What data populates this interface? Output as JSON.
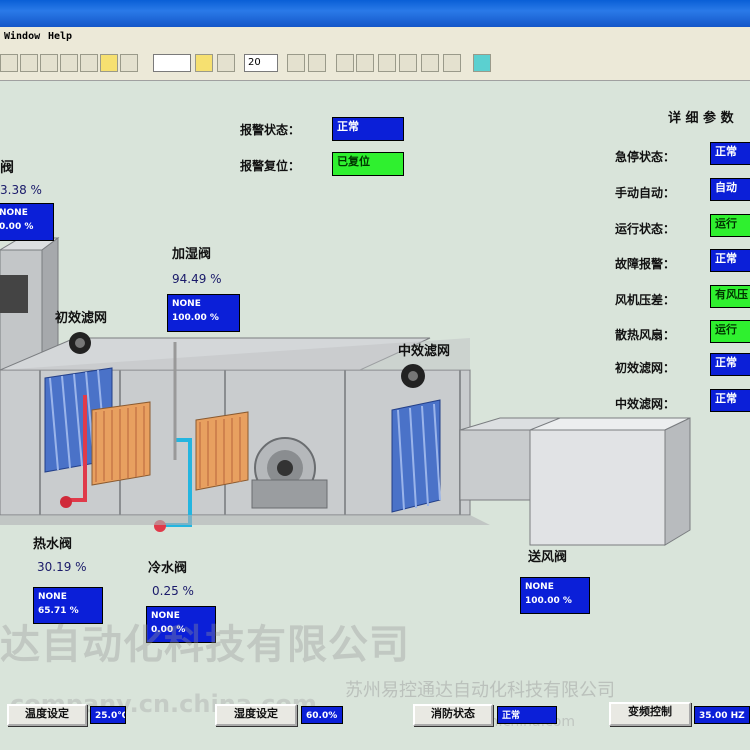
{
  "menu": {
    "window": "Window",
    "help": "Help"
  },
  "toolbar": {
    "zoom": "20"
  },
  "alarm": {
    "status_label": "报警状态：",
    "status_value": "正常",
    "reset_label": "报警复位：",
    "reset_value": "已复位"
  },
  "details": {
    "title": "详 细 参 数",
    "rows": [
      {
        "label": "急停状态：",
        "value": "正常",
        "color": "#0b1fd8"
      },
      {
        "label": "手动自动：",
        "value": "自动",
        "color": "#0b1fd8"
      },
      {
        "label": "运行状态：",
        "value": "运行",
        "color": "#2ff02f"
      },
      {
        "label": "故障报警：",
        "value": "正常",
        "color": "#0b1fd8"
      },
      {
        "label": "风机压差：",
        "value": "有风压",
        "color": "#2ff02f"
      },
      {
        "label": "散热风扇：",
        "value": "运行",
        "color": "#2ff02f"
      },
      {
        "label": "初效滤网：",
        "value": "正常",
        "color": "#0b1fd8"
      },
      {
        "label": "中效滤网：",
        "value": "正常",
        "color": "#0b1fd8"
      }
    ]
  },
  "left_valve": {
    "title": "阀",
    "percent": "3.38 %",
    "line1": "NONE",
    "line2": "0.00 %"
  },
  "humidifier": {
    "title": "加湿阀",
    "percent": "94.49 %",
    "line1": "NONE",
    "line2": "100.00 %"
  },
  "primary_filter": {
    "title": "初效滤网"
  },
  "medium_filter": {
    "title": "中效滤网"
  },
  "hot_water": {
    "title": "热水阀",
    "percent": "30.19 %",
    "line1": "NONE",
    "line2": "65.71 %"
  },
  "cold_water": {
    "title": "冷水阀",
    "percent": "0.25 %",
    "line1": "NONE",
    "line2": "0.00 %"
  },
  "supply_air": {
    "title": "送风阀",
    "line1": "NONE",
    "line2": "100.00 %"
  },
  "bottom": {
    "btn1": "温度设定",
    "val1": "25.0℃",
    "btn2": "湿度设定",
    "val2": "60.0%",
    "btn3": "消防状态",
    "val3": "正常",
    "btn4": "变频控制",
    "val4": "35.00 HZ"
  },
  "watermark": {
    "big": "达自动化科技有限公司",
    "small": "苏州易控通达自动化科技有限公司",
    "url": "company.cn.china.com",
    "url2": "sbone.cn.china.com"
  },
  "colors": {
    "accent_blue": "#0b1fd8",
    "status_green": "#2ff02f",
    "background": "#d9e4da"
  }
}
